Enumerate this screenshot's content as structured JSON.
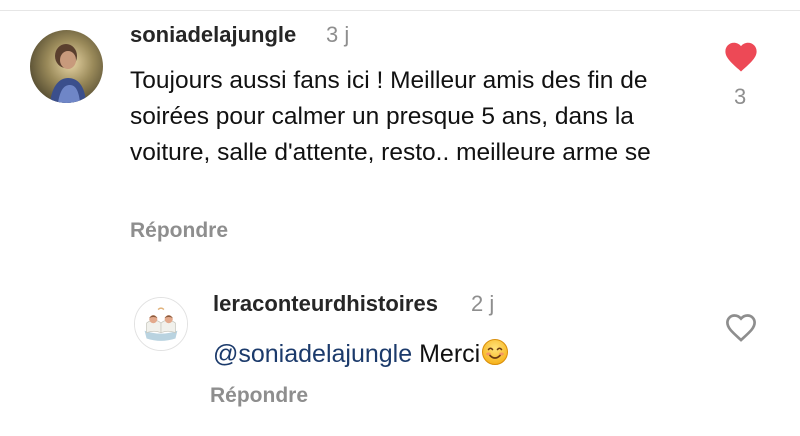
{
  "comments": [
    {
      "username": "soniadelajungle",
      "time": "3 j",
      "text": "Toujours aussi fans ici ! Meilleur amis des fin de soirées pour calmer un presque 5 ans, dans la voiture, salle d'attente, resto.. meilleure arme se",
      "reply_label": "Répondre",
      "liked": true,
      "like_count": "3",
      "like_icon": "heart-filled-icon",
      "like_color": "#ed4956"
    },
    {
      "username": "leraconteurdhistoires",
      "time": "2 j",
      "mention": "@soniadelajungle",
      "text": "Merci",
      "emoji": "smiling-face-emoji",
      "reply_label": "Répondre",
      "liked": false,
      "like_icon": "heart-outline-icon"
    }
  ],
  "colors": {
    "username": "#262626",
    "muted": "#8e8e8e",
    "mention": "#1b3a6b",
    "like": "#ed4956"
  }
}
